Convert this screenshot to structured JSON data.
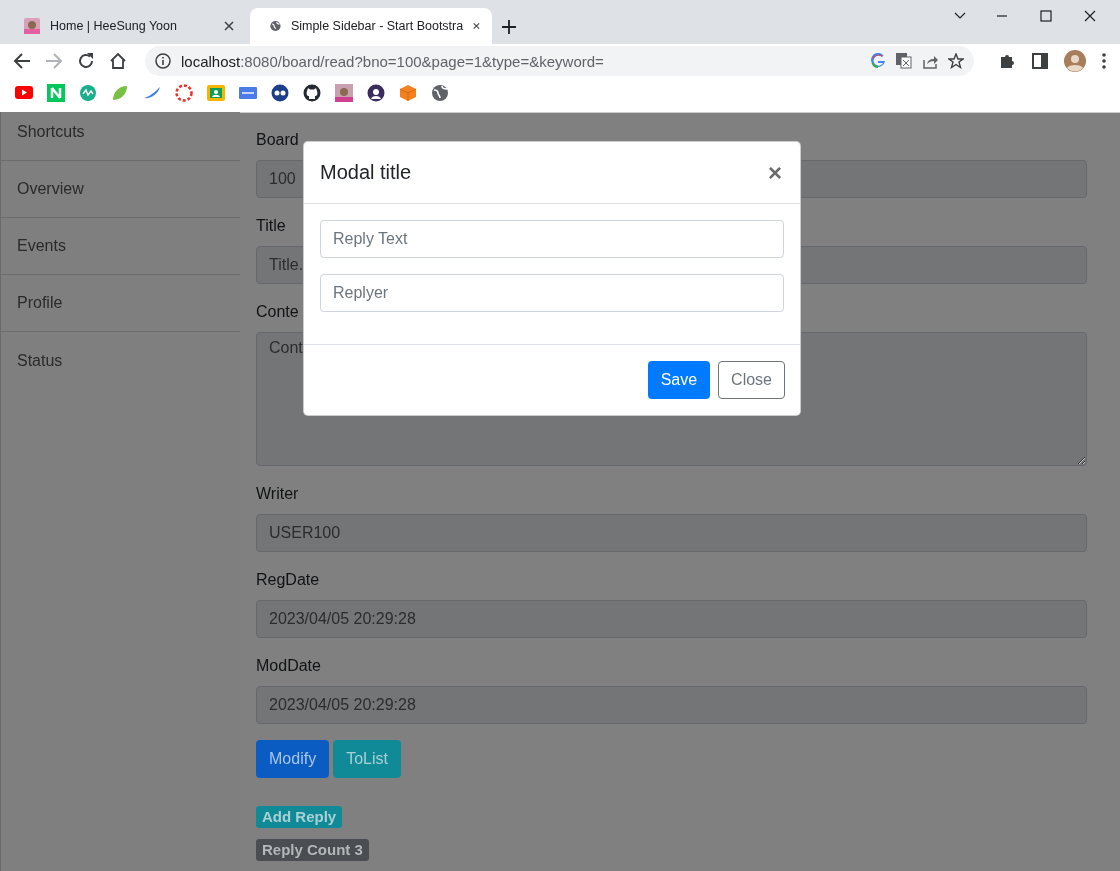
{
  "browser": {
    "tabs": [
      {
        "title": "Home | HeeSung Yoon",
        "selected": false,
        "kind": "photo"
      },
      {
        "title": "Simple Sidebar - Start Bootstra",
        "selected": true,
        "kind": "globe"
      }
    ],
    "address": {
      "host": "localhost",
      "rest": ":8080/board/read?bno=100&page=1&type=&keyword="
    }
  },
  "sidebar": {
    "items": [
      "Shortcuts",
      "Overview",
      "Events",
      "Profile",
      "Status"
    ]
  },
  "form": {
    "fields": [
      {
        "label": "Board",
        "value": "100",
        "kind": "input"
      },
      {
        "label": "Title",
        "value": "Title.",
        "kind": "input"
      },
      {
        "label": "Conte",
        "value": "Cont",
        "kind": "textarea"
      },
      {
        "label": "Writer",
        "value": "USER100",
        "kind": "input"
      },
      {
        "label": "RegDate",
        "value": "2023/04/05 20:29:28",
        "kind": "input"
      },
      {
        "label": "ModDate",
        "value": "2023/04/05 20:29:28",
        "kind": "input"
      }
    ],
    "buttons": [
      {
        "label": "Modify",
        "kind": "primary"
      },
      {
        "label": "ToList",
        "kind": "info"
      }
    ],
    "badges": [
      {
        "label": "Add Reply",
        "kind": "info"
      },
      {
        "label": "Reply Count 3",
        "kind": "secondary"
      }
    ]
  },
  "modal": {
    "title": "Modal title",
    "close": "×",
    "fields": [
      {
        "placeholder": "Reply Text"
      },
      {
        "placeholder": "Replyer"
      }
    ],
    "buttons": [
      {
        "label": "Save",
        "kind": "primary"
      },
      {
        "label": "Close",
        "kind": "outline"
      }
    ]
  }
}
